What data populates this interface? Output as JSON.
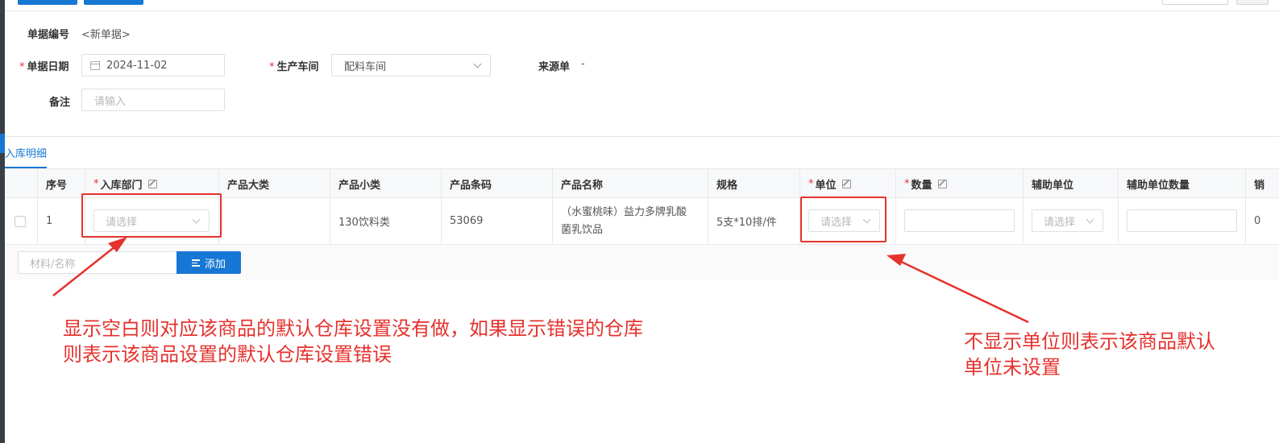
{
  "form": {
    "doc_no_label": "单据编号",
    "doc_no_value": "<新单据>",
    "date_label": "单据日期",
    "date_value": "2024-11-02",
    "workshop_label": "生产车间",
    "workshop_value": "配料车间",
    "source_label": "来源单",
    "source_value": "-",
    "remark_label": "备注",
    "remark_placeholder": "请输入",
    "required_mark": "*"
  },
  "tabs": [
    {
      "label": "入库明细",
      "active": true
    }
  ],
  "table": {
    "columns": [
      {
        "label": "序号"
      },
      {
        "label": "入库部门",
        "required": true,
        "editable": true
      },
      {
        "label": "产品大类"
      },
      {
        "label": "产品小类"
      },
      {
        "label": "产品条码"
      },
      {
        "label": "产品名称"
      },
      {
        "label": "规格"
      },
      {
        "label": "单位",
        "required": true,
        "editable": true
      },
      {
        "label": "数量",
        "required": true,
        "editable": true
      },
      {
        "label": "辅助单位"
      },
      {
        "label": "辅助单位数量"
      },
      {
        "label": "销"
      }
    ],
    "rows": [
      {
        "index": "1",
        "department_placeholder": "请选择",
        "category": "",
        "subcategory": "130饮料类",
        "barcode": "53069",
        "name_line1": "（水蜜桃味）益力多牌乳酸",
        "name_line2": "菌乳饮品",
        "spec": "5支*10排/件",
        "unit_placeholder": "请选择",
        "quantity": "",
        "aux_unit_placeholder": "请选择",
        "aux_quantity": "",
        "last_col": "0"
      }
    ]
  },
  "add_bar": {
    "placeholder": "材料/名称",
    "button_label": "添加"
  },
  "annotations": {
    "left_line1": "显示空白则对应该商品的默认仓库设置没有做，如果显示错误的仓库",
    "left_line2": "则表示该商品设置的默认仓库设置错误",
    "right_line1": "不显示单位则表示该商品默认",
    "right_line2": "单位未设置"
  },
  "colors": {
    "primary": "#1677d4",
    "required": "#e5322d",
    "annotation": "#e5322d"
  }
}
